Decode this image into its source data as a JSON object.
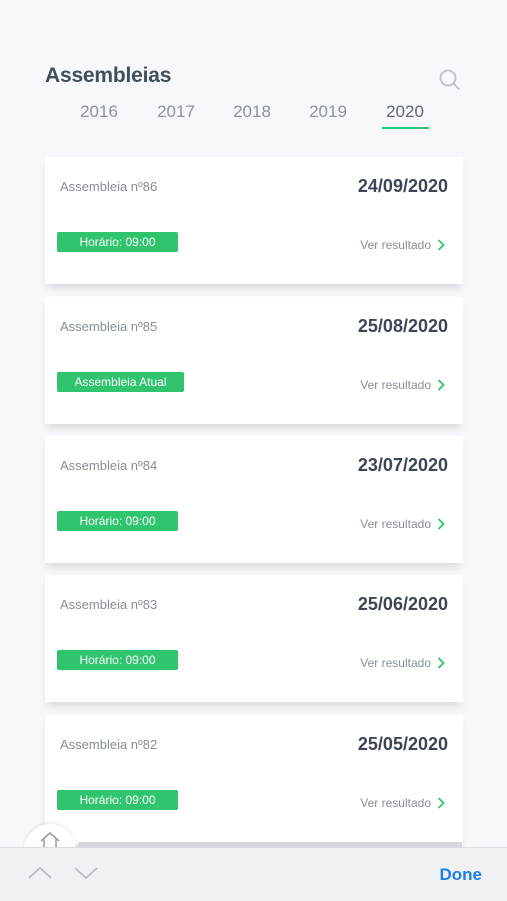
{
  "header": {
    "title": "Assembleias",
    "search_icon": "search-icon",
    "tabs": [
      "2016",
      "2017",
      "2018",
      "2019",
      "2020"
    ],
    "active_tab": "2020"
  },
  "cards": [
    {
      "title": "Assembleia nº86",
      "date": "24/09/2020",
      "badge": "Horário: 09:00",
      "link": "Ver resultado"
    },
    {
      "title": "Assembleia nº85",
      "date": "25/08/2020",
      "badge": "Assembleia Atual",
      "link": "Ver resultado"
    },
    {
      "title": "Assembleia nº84",
      "date": "23/07/2020",
      "badge": "Horário: 09:00",
      "link": "Ver resultado"
    },
    {
      "title": "Assembleia nº83",
      "date": "25/06/2020",
      "badge": "Horário: 09:00",
      "link": "Ver resultado"
    },
    {
      "title": "Assembleia nº82",
      "date": "25/05/2020",
      "badge": "Horário: 09:00",
      "link": "Ver resultado"
    }
  ],
  "toolbar": {
    "done_label": "Done"
  },
  "colors": {
    "accent_green": "#2fc46d",
    "done_blue": "#1f7fe6"
  }
}
